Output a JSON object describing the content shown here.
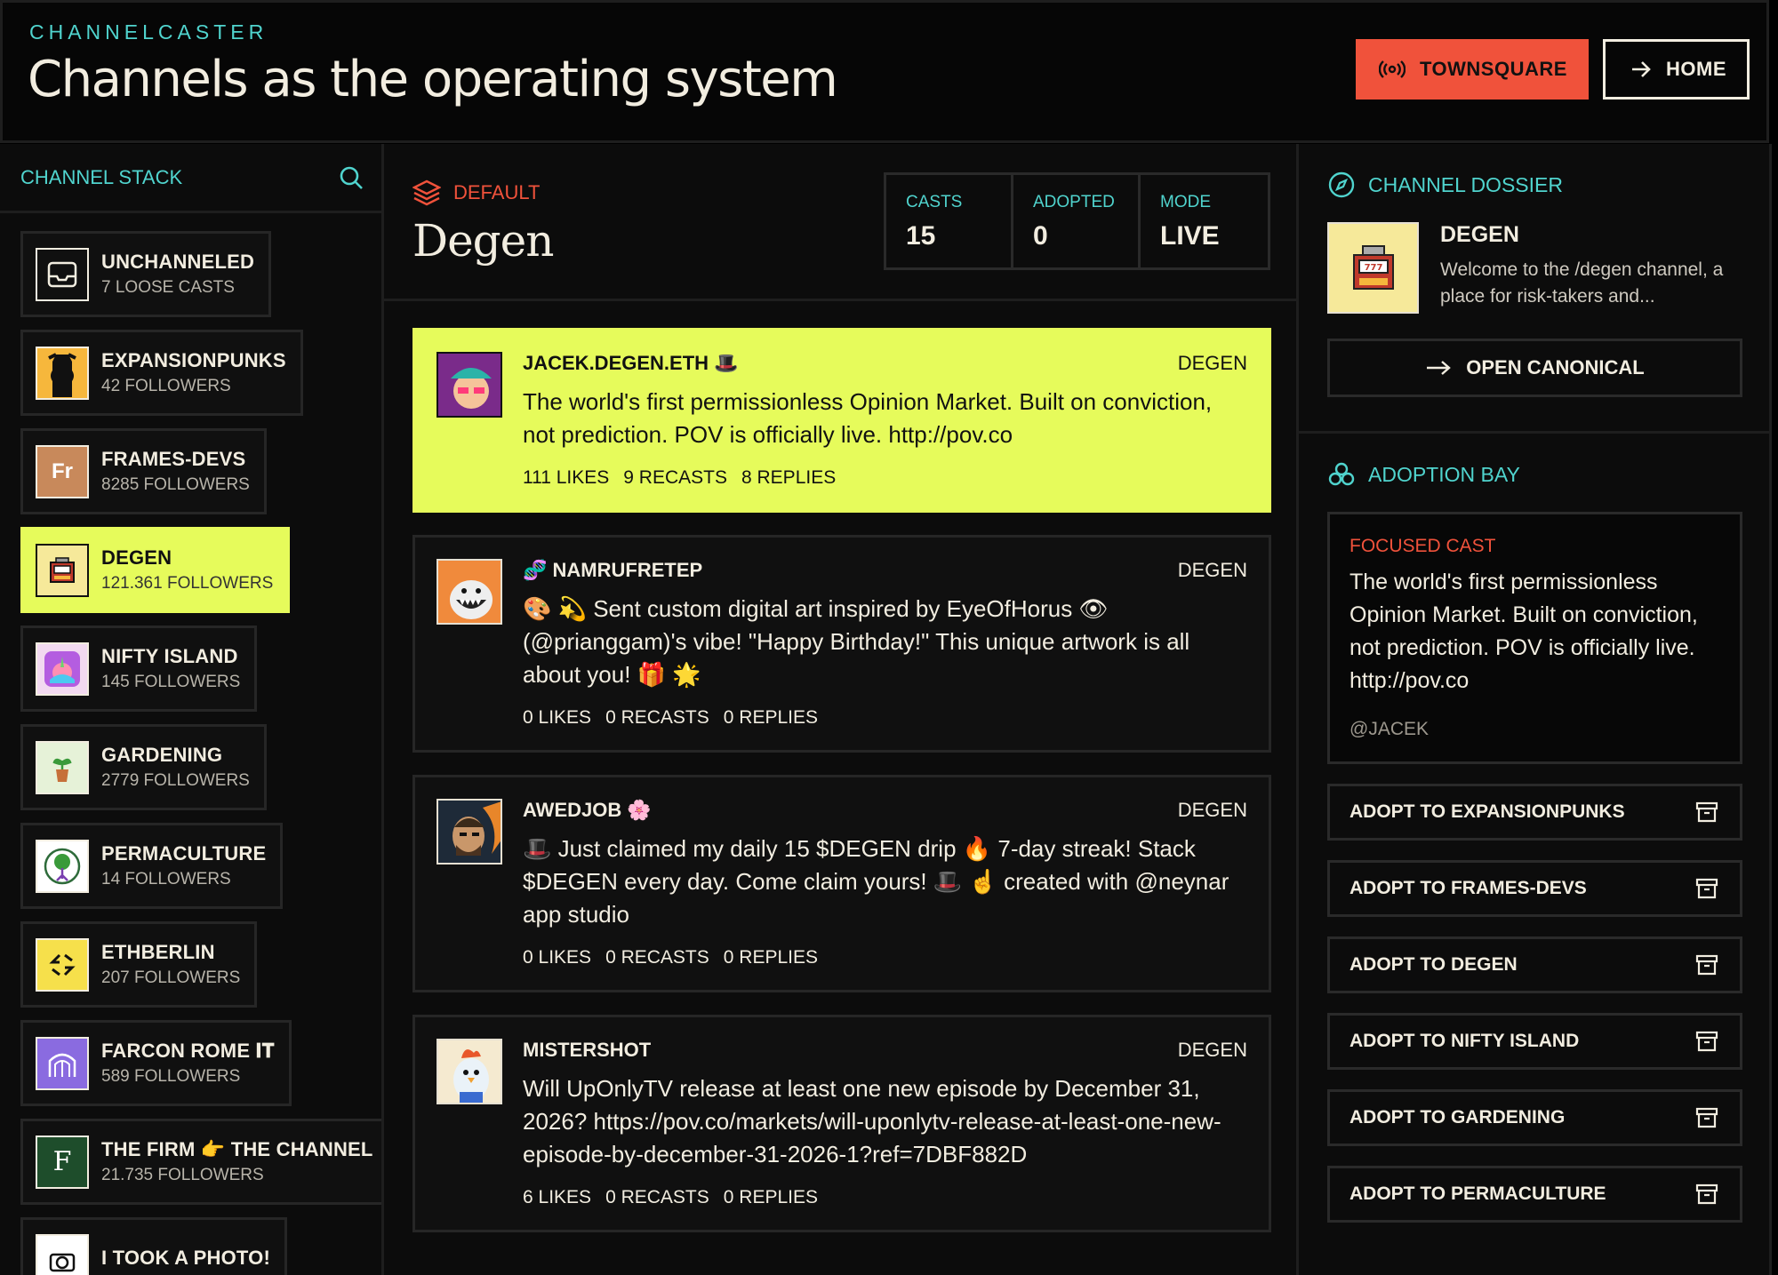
{
  "header": {
    "brand": "CHANNELCASTER",
    "headline": "Channels as the operating system",
    "townsquare_label": "TOWNSQUARE",
    "home_label": "HOME"
  },
  "sidebar": {
    "title": "CHANNEL STACK",
    "items": [
      {
        "name": "UNCHANNELED",
        "sub": "7 LOOSE CASTS",
        "icon": "inbox-icon"
      },
      {
        "name": "EXPANSIONPUNKS",
        "sub": "42 FOLLOWERS",
        "icon": "punk-icon"
      },
      {
        "name": "FRAMES-DEVS",
        "sub": "8285 FOLLOWERS",
        "icon_text": "Fr"
      },
      {
        "name": "DEGEN",
        "sub": "121.361 FOLLOWERS",
        "icon": "slot-machine-icon",
        "active": true
      },
      {
        "name": "NIFTY ISLAND",
        "sub": "145 FOLLOWERS",
        "icon": "island-icon"
      },
      {
        "name": "GARDENING",
        "sub": "2779 FOLLOWERS",
        "icon": "plant-icon"
      },
      {
        "name": "PERMACULTURE",
        "sub": "14 FOLLOWERS",
        "icon": "tree-icon"
      },
      {
        "name": "ETHBERLIN",
        "sub": "207 FOLLOWERS",
        "icon": "ethberlin-icon"
      },
      {
        "name": "FARCON ROME 𝐈𝐓",
        "sub": "589 FOLLOWERS",
        "icon": "arch-icon"
      },
      {
        "name": "THE FIRM 👉 THE CHANNEL",
        "sub": "21.735 FOLLOWERS",
        "icon_text": "F"
      },
      {
        "name": "I TOOK A PHOTO!",
        "sub": "",
        "icon": "camera-icon"
      }
    ]
  },
  "main": {
    "kicker": "DEFAULT",
    "title": "Degen",
    "stats": [
      {
        "label": "CASTS",
        "value": "15"
      },
      {
        "label": "ADOPTED",
        "value": "0"
      },
      {
        "label": "MODE",
        "value": "LIVE"
      }
    ],
    "casts": [
      {
        "author": "JACEK.DEGEN.ETH 🎩",
        "channel": "DEGEN",
        "text": "The world's first permissionless Opinion Market. Built on conviction, not prediction. POV is officially live. http://pov.co",
        "likes": "111 LIKES",
        "recasts": "9 RECASTS",
        "replies": "8 REPLIES",
        "active": true
      },
      {
        "author": "🧬 NAMRUFRETEP",
        "channel": "DEGEN",
        "text": "🎨 💫 Sent custom digital art inspired by EyeOfHorus 👁 (@prianggam)'s vibe! \"Happy Birthday!\" This unique artwork is all about you! 🎁 🌟",
        "likes": "0 LIKES",
        "recasts": "0 RECASTS",
        "replies": "0 REPLIES"
      },
      {
        "author": "AWEDJOB 🌸",
        "channel": "DEGEN",
        "text": "🎩 Just claimed my daily 15 $DEGEN drip 🔥 7-day streak! Stack $DEGEN every day. Come claim yours! 🎩 ☝️ created with @neynar app studio",
        "likes": "0 LIKES",
        "recasts": "0 RECASTS",
        "replies": "0 REPLIES"
      },
      {
        "author": "MISTERSHOT",
        "channel": "DEGEN",
        "text": "Will UpOnlyTV release at least one new episode by December 31, 2026? https://pov.co/markets/will-uponlytv-release-at-least-one-new-episode-by-december-31-2026-1?ref=7DBF882D",
        "likes": "6 LIKES",
        "recasts": "0 RECASTS",
        "replies": "0 REPLIES"
      }
    ]
  },
  "dossier": {
    "title": "CHANNEL DOSSIER",
    "name": "DEGEN",
    "desc": "Welcome to the /degen channel, a place for risk-takers and...",
    "open_label": "OPEN CANONICAL"
  },
  "adoption": {
    "title": "ADOPTION BAY",
    "focused_label": "FOCUSED CAST",
    "focused_text": "The world's first permissionless Opinion Market. Built on conviction, not prediction. POV is officially live. http://pov.co",
    "focused_author": "@JACEK",
    "buttons": [
      "ADOPT TO EXPANSIONPUNKS",
      "ADOPT TO FRAMES-DEVS",
      "ADOPT TO DEGEN",
      "ADOPT TO NIFTY ISLAND",
      "ADOPT TO GARDENING",
      "ADOPT TO PERMACULTURE"
    ]
  },
  "colors": {
    "accent_teal": "#50d4ce",
    "accent_lime": "#e6fb5b",
    "accent_orange": "#f0523b",
    "background": "#0c0c0c"
  }
}
